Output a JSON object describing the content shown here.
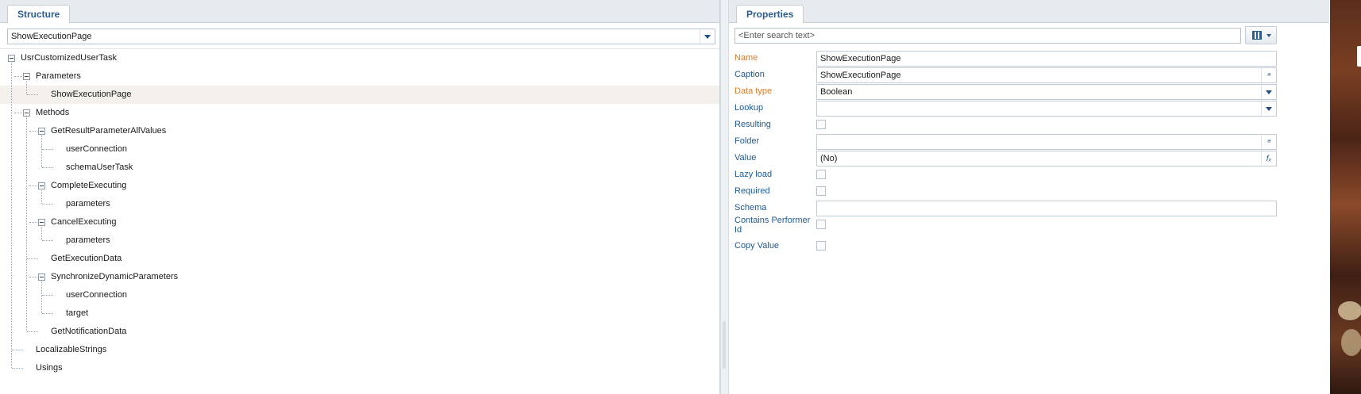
{
  "structure": {
    "tab_label": "Structure",
    "selector_value": "ShowExecutionPage",
    "tree": [
      {
        "label": "UsrCustomizedUserTask",
        "level": 0,
        "expandable": true,
        "selected": false
      },
      {
        "label": "Parameters",
        "level": 1,
        "expandable": true,
        "selected": false
      },
      {
        "label": "ShowExecutionPage",
        "level": 2,
        "expandable": false,
        "selected": true
      },
      {
        "label": "Methods",
        "level": 1,
        "expandable": true,
        "selected": false
      },
      {
        "label": "GetResultParameterAllValues",
        "level": 2,
        "expandable": true,
        "selected": false
      },
      {
        "label": "userConnection",
        "level": 3,
        "expandable": false,
        "selected": false
      },
      {
        "label": "schemaUserTask",
        "level": 3,
        "expandable": false,
        "selected": false
      },
      {
        "label": "CompleteExecuting",
        "level": 2,
        "expandable": true,
        "selected": false
      },
      {
        "label": "parameters",
        "level": 3,
        "expandable": false,
        "selected": false
      },
      {
        "label": "CancelExecuting",
        "level": 2,
        "expandable": true,
        "selected": false
      },
      {
        "label": "parameters",
        "level": 3,
        "expandable": false,
        "selected": false
      },
      {
        "label": "GetExecutionData",
        "level": 2,
        "expandable": false,
        "selected": false
      },
      {
        "label": "SynchronizeDynamicParameters",
        "level": 2,
        "expandable": true,
        "selected": false
      },
      {
        "label": "userConnection",
        "level": 3,
        "expandable": false,
        "selected": false
      },
      {
        "label": "target",
        "level": 3,
        "expandable": false,
        "selected": false
      },
      {
        "label": "GetNotificationData",
        "level": 2,
        "expandable": false,
        "selected": false
      },
      {
        "label": "LocalizableStrings",
        "level": 1,
        "expandable": false,
        "selected": false
      },
      {
        "label": "Usings",
        "level": 1,
        "expandable": false,
        "selected": false
      }
    ]
  },
  "properties": {
    "tab_label": "Properties",
    "search_placeholder": "<Enter search text>",
    "rows": [
      {
        "key": "name",
        "label": "Name",
        "required": true,
        "control": "text",
        "value": "ShowExecutionPage"
      },
      {
        "key": "caption",
        "label": "Caption",
        "required": false,
        "control": "text-localizable",
        "value": "ShowExecutionPage"
      },
      {
        "key": "data-type",
        "label": "Data type",
        "required": true,
        "control": "dropdown",
        "value": "Boolean"
      },
      {
        "key": "lookup",
        "label": "Lookup",
        "required": false,
        "control": "dropdown",
        "value": ""
      },
      {
        "key": "resulting",
        "label": "Resulting",
        "required": false,
        "control": "checkbox",
        "value": false
      },
      {
        "key": "folder",
        "label": "Folder",
        "required": false,
        "control": "text-localizable",
        "value": ""
      },
      {
        "key": "value",
        "label": "Value",
        "required": false,
        "control": "text-formula",
        "value": "(No)"
      },
      {
        "key": "lazy-load",
        "label": "Lazy load",
        "required": false,
        "control": "checkbox",
        "value": false
      },
      {
        "key": "required",
        "label": "Required",
        "required": false,
        "control": "checkbox",
        "value": false
      },
      {
        "key": "schema",
        "label": "Schema",
        "required": false,
        "control": "text",
        "value": ""
      },
      {
        "key": "contains-performer-id",
        "label": "Contains Performer Id",
        "required": false,
        "control": "checkbox",
        "value": false
      },
      {
        "key": "copy-value",
        "label": "Copy Value",
        "required": false,
        "control": "checkbox",
        "value": false
      }
    ]
  },
  "icons": {
    "expand_collapse": "minus-box-icon",
    "dropdown": "dropdown-arrow-icon",
    "localize": "localize-icon",
    "formula": "fx-formula-icon",
    "view_mode": "grid-view-icon"
  },
  "colors": {
    "accent": "#1f5a91",
    "required_label": "#e07a1f",
    "selected_row": "#f4f1ec"
  }
}
